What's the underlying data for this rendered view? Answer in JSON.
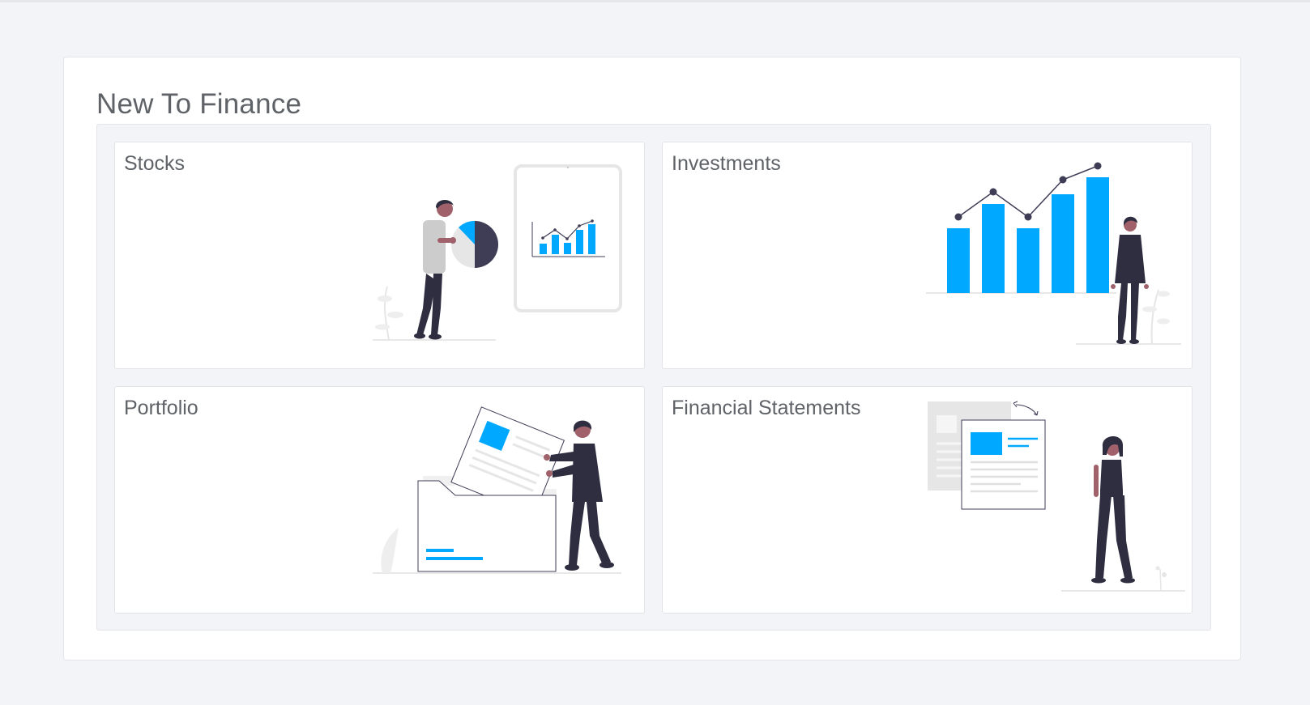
{
  "section": {
    "title": "New To Finance"
  },
  "tiles": [
    {
      "label": "Stocks",
      "illustration": "person-holding-pie-chart-with-tablet-chart"
    },
    {
      "label": "Investments",
      "illustration": "person-beside-bar-chart-with-trend-line"
    },
    {
      "label": "Portfolio",
      "illustration": "person-filing-document-into-folder"
    },
    {
      "label": "Financial Statements",
      "illustration": "person-beside-report-documents"
    }
  ],
  "colors": {
    "accent": "#00a8ff",
    "figure_dark": "#2f2e41",
    "skin": "#a0616a",
    "light_gray": "#e6e6e6",
    "background": "#f3f4f7"
  }
}
